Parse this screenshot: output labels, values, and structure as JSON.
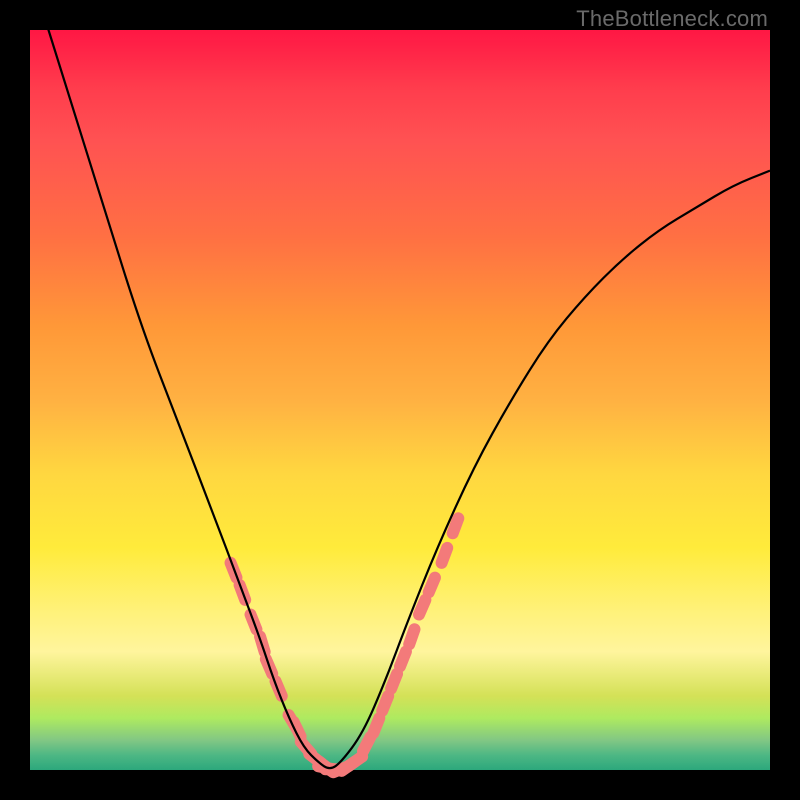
{
  "watermark": "TheBottleneck.com",
  "chart_data": {
    "type": "line",
    "title": "",
    "xlabel": "",
    "ylabel": "",
    "xlim": [
      0,
      100
    ],
    "ylim": [
      0,
      100
    ],
    "series": [
      {
        "name": "curve",
        "x": [
          0,
          5,
          10,
          15,
          20,
          25,
          28,
          31,
          33,
          35,
          37,
          39,
          40.5,
          42,
          45,
          48,
          51,
          55,
          60,
          65,
          70,
          75,
          80,
          85,
          90,
          95,
          100
        ],
        "y": [
          108,
          92,
          76,
          60,
          47,
          34,
          26,
          18,
          12,
          7,
          3,
          1,
          0,
          1,
          5,
          12,
          20,
          30,
          41,
          50,
          58,
          64,
          69,
          73,
          76,
          79,
          81
        ]
      },
      {
        "name": "highlight-left",
        "x": [
          27.5,
          28.7,
          30.2,
          31.4,
          32.3,
          33.6,
          35.5,
          36.1,
          37.3,
          38.6,
          39.9
        ],
        "y": [
          27,
          24,
          20,
          17,
          14,
          11,
          6.5,
          5.5,
          3,
          1.5,
          0.5
        ]
      },
      {
        "name": "highlight-bottom",
        "x": [
          40,
          41,
          42,
          43,
          44
        ],
        "y": [
          0.3,
          0.1,
          0.1,
          0.5,
          1.2
        ]
      },
      {
        "name": "highlight-right",
        "x": [
          45.5,
          46.8,
          48.0,
          49.2,
          50.4,
          51.6,
          53.0,
          54.3,
          56.0,
          57.5
        ],
        "y": [
          3.5,
          6,
          9,
          12,
          15,
          18,
          22,
          25,
          29,
          33
        ]
      }
    ],
    "colors": {
      "curve": "#000000",
      "highlight": "#f37a7a",
      "gradient_top": "#ff1744",
      "gradient_bottom": "#2ca87c"
    }
  }
}
